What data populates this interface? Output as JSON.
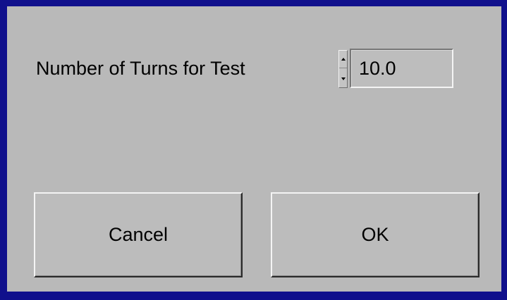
{
  "dialog": {
    "field_label": "Number of Turns for Test",
    "turns_value": "10.0",
    "cancel_label": "Cancel",
    "ok_label": "OK"
  },
  "colors": {
    "window_border": "#10108c",
    "dialog_background": "#b9b9b9"
  },
  "icons": {
    "spinner_up": "triangle-up-icon",
    "spinner_down": "triangle-down-icon"
  }
}
